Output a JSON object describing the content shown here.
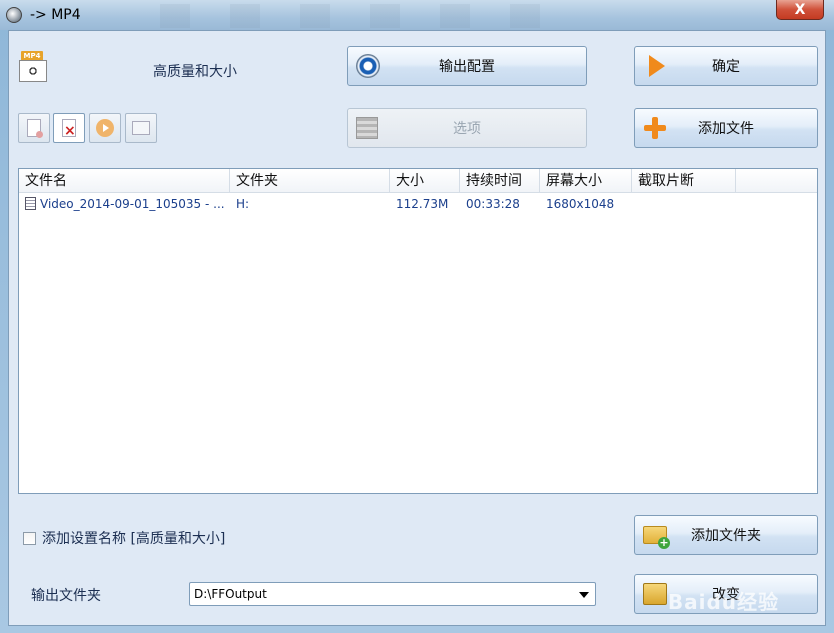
{
  "window": {
    "title": "-> MP4",
    "close_label": "X"
  },
  "format": {
    "icon_tag": "MP4",
    "quality_label": "高质量和大小"
  },
  "buttons": {
    "output_config": "输出配置",
    "ok": "确定",
    "options": "选项",
    "add_file": "添加文件",
    "add_folder": "添加文件夹",
    "change": "改变"
  },
  "file_list": {
    "columns": [
      "文件名",
      "文件夹",
      "大小",
      "持续时间",
      "屏幕大小",
      "截取片断"
    ],
    "rows": [
      {
        "name": "Video_2014-09-01_105035 - ...",
        "folder": "H:",
        "size": "112.73M",
        "duration": "00:33:28",
        "resolution": "1680x1048",
        "clip": ""
      }
    ]
  },
  "settings": {
    "add_setting_name_label": "添加设置名称 [高质量和大小]",
    "add_setting_name_checked": false,
    "output_folder_label": "输出文件夹",
    "output_folder_value": "D:\\FFOutput"
  },
  "watermark": "Baidu经验"
}
